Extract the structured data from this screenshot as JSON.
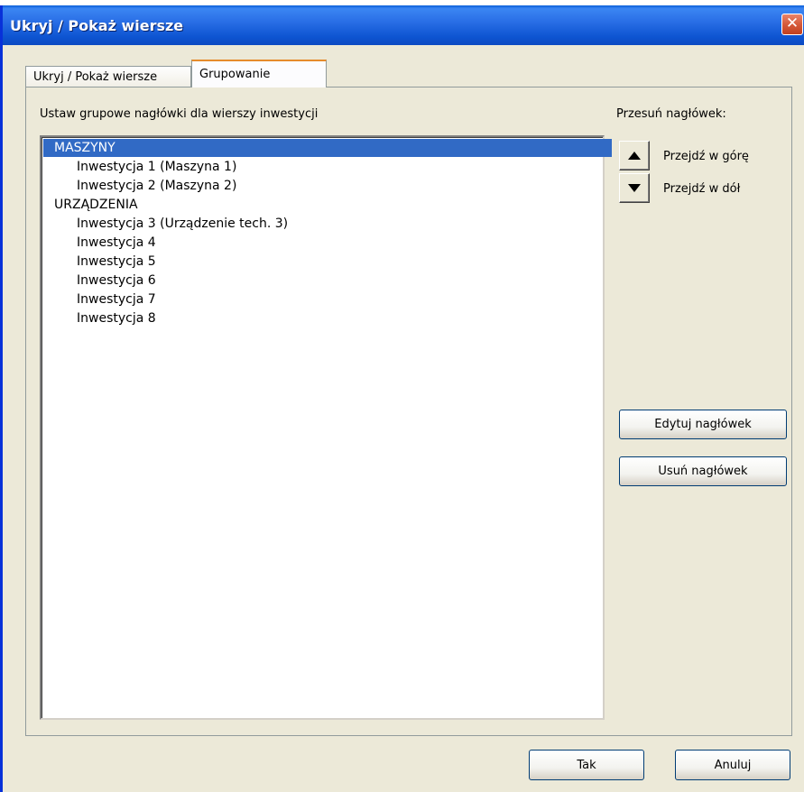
{
  "window": {
    "title": "Ukryj / Pokaż wiersze",
    "close_symbol": "✕"
  },
  "tabs": [
    {
      "label": "Ukryj / Pokaż wiersze",
      "active": false
    },
    {
      "label": "Grupowanie",
      "active": true
    }
  ],
  "panel": {
    "instruction": "Ustaw grupowe nagłówki dla wierszy inwestycji",
    "list": [
      {
        "text": "MASZYNY",
        "level": 0,
        "selected": true
      },
      {
        "text": "Inwestycja 1 (Maszyna 1)",
        "level": 1,
        "selected": false
      },
      {
        "text": "Inwestycja 2 (Maszyna 2)",
        "level": 1,
        "selected": false
      },
      {
        "text": "URZĄDZENIA",
        "level": 0,
        "selected": false
      },
      {
        "text": "Inwestycja 3 (Urządzenie tech. 3)",
        "level": 1,
        "selected": false
      },
      {
        "text": "Inwestycja 4",
        "level": 1,
        "selected": false
      },
      {
        "text": "Inwestycja 5",
        "level": 1,
        "selected": false
      },
      {
        "text": "Inwestycja 6",
        "level": 1,
        "selected": false
      },
      {
        "text": "Inwestycja 7",
        "level": 1,
        "selected": false
      },
      {
        "text": "Inwestycja 8",
        "level": 1,
        "selected": false
      }
    ],
    "move_header_label": "Przesuń nagłówek:",
    "move_up_label": "Przejdź w górę",
    "move_down_label": "Przejdź w dół",
    "edit_header_button": "Edytuj nagłówek",
    "delete_header_button": "Usuń nagłówek"
  },
  "footer": {
    "ok_button": "Tak",
    "cancel_button": "Anuluj"
  },
  "icons": {
    "up": "arrow-up-icon",
    "down": "arrow-down-icon",
    "close": "close-icon"
  },
  "colors": {
    "titlebar": "#0c4ac2",
    "selection": "#316ac5",
    "dialog_bg": "#ece9d8"
  }
}
